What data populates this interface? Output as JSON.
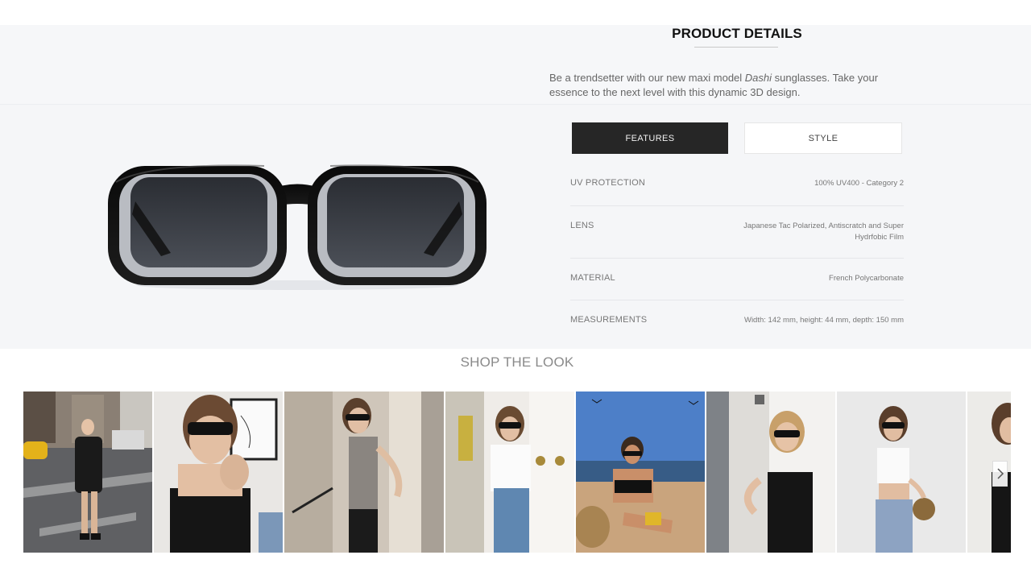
{
  "product_details": {
    "title": "PRODUCT DETAILS",
    "description_before": "Be a trendsetter with our new maxi model ",
    "description_model": "Dashi",
    "description_after": " sunglasses. Take your essence to the next level with this dynamic 3D design."
  },
  "tabs": [
    {
      "label": "FEATURES",
      "active": true
    },
    {
      "label": "STYLE",
      "active": false
    }
  ],
  "specs": [
    {
      "label": "UV PROTECTION",
      "value": "100% UV400 - Category 2"
    },
    {
      "label": "LENS",
      "value": "Japanese Tac Polarized, Antiscratch and Super Hydrfobic Film"
    },
    {
      "label": "MATERIAL",
      "value": "French Polycarbonate"
    },
    {
      "label": "MEASUREMENTS",
      "value": "Width: 142 mm, height: 44 mm, depth: 150 mm"
    }
  ],
  "shop_the_look": {
    "title": "SHOP THE LOOK",
    "next_icon": "chevron-right-icon"
  },
  "colors": {
    "active_tab_bg": "#262626",
    "panel_bg": "#f5f6f8",
    "text_muted": "#777777"
  }
}
